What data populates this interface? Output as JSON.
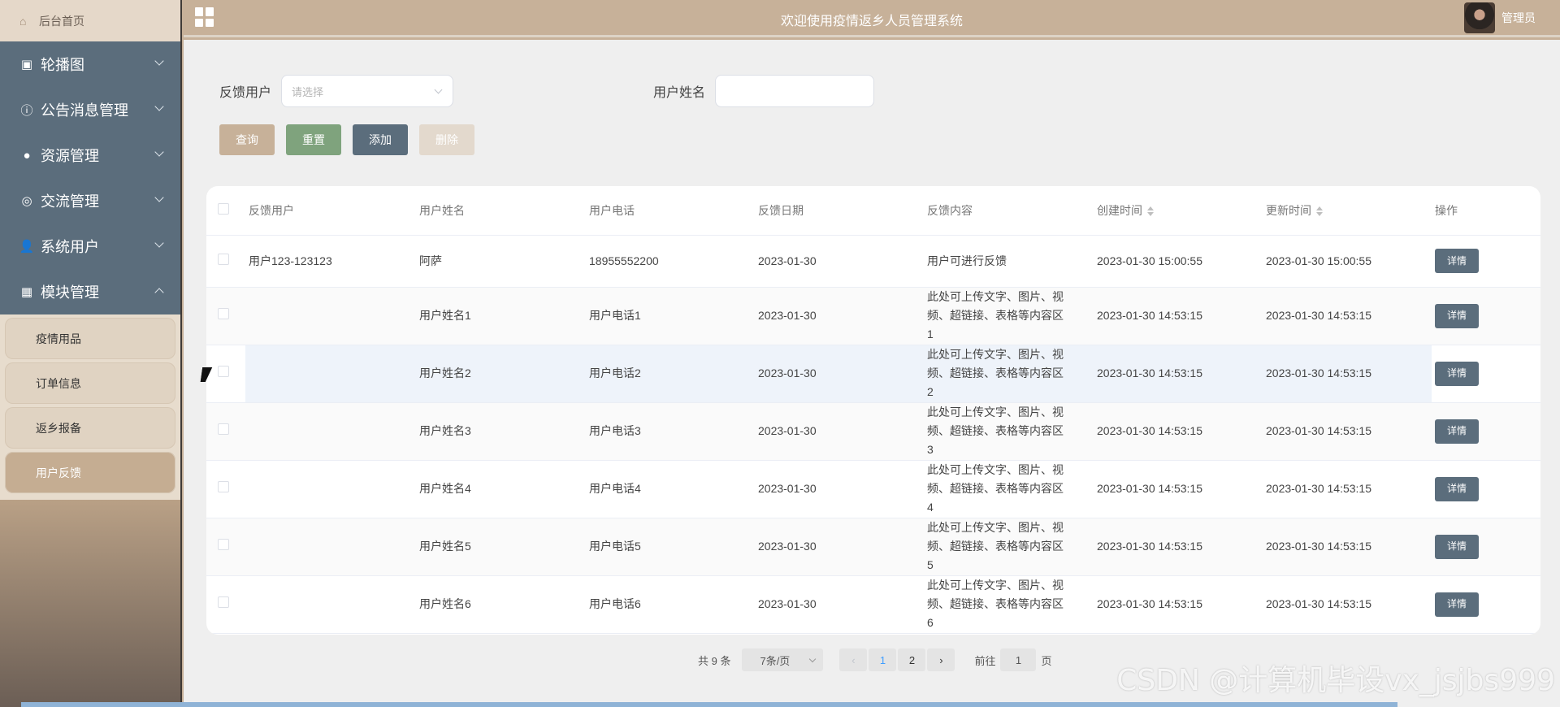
{
  "sidebar": {
    "home_label": "后台首页",
    "menu": [
      {
        "label": "轮播图",
        "icon": "image-icon"
      },
      {
        "label": "公告消息管理",
        "icon": "info-circle-icon"
      },
      {
        "label": "资源管理",
        "icon": "bulb-icon"
      },
      {
        "label": "交流管理",
        "icon": "chat-icon"
      },
      {
        "label": "系统用户",
        "icon": "user-icon"
      },
      {
        "label": "模块管理",
        "icon": "grid-icon"
      }
    ],
    "submenu": [
      "疫情用品",
      "订单信息",
      "返乡报备",
      "用户反馈"
    ],
    "active_submenu": "用户反馈"
  },
  "header": {
    "title": "欢迎使用疫情返乡人员管理系统",
    "user": "管理员"
  },
  "filters": {
    "feedback_user_label": "反馈用户",
    "feedback_user_placeholder": "请选择",
    "user_name_label": "用户姓名",
    "user_name_value": ""
  },
  "buttons": {
    "query": "查询",
    "reset": "重置",
    "add": "添加",
    "delete": "删除"
  },
  "table": {
    "columns": [
      "反馈用户",
      "用户姓名",
      "用户电话",
      "反馈日期",
      "反馈内容",
      "创建时间",
      "更新时间",
      "操作"
    ],
    "rows": [
      {
        "feedback_user": "用户123-123123",
        "name": "阿萨",
        "phone": "18955552200",
        "date": "2023-01-30",
        "content": "用户可进行反馈",
        "created": "2023-01-30 15:00:55",
        "updated": "2023-01-30 15:00:55",
        "action": "详情"
      },
      {
        "feedback_user": "",
        "name": "用户姓名1",
        "phone": "用户电话1",
        "date": "2023-01-30",
        "content": "此处可上传文字、图片、视频、超链接、表格等内容区1",
        "created": "2023-01-30 14:53:15",
        "updated": "2023-01-30 14:53:15",
        "action": "详情"
      },
      {
        "feedback_user": "",
        "name": "用户姓名2",
        "phone": "用户电话2",
        "date": "2023-01-30",
        "content": "此处可上传文字、图片、视频、超链接、表格等内容区2",
        "created": "2023-01-30 14:53:15",
        "updated": "2023-01-30 14:53:15",
        "action": "详情"
      },
      {
        "feedback_user": "",
        "name": "用户姓名3",
        "phone": "用户电话3",
        "date": "2023-01-30",
        "content": "此处可上传文字、图片、视频、超链接、表格等内容区3",
        "created": "2023-01-30 14:53:15",
        "updated": "2023-01-30 14:53:15",
        "action": "详情"
      },
      {
        "feedback_user": "",
        "name": "用户姓名4",
        "phone": "用户电话4",
        "date": "2023-01-30",
        "content": "此处可上传文字、图片、视频、超链接、表格等内容区4",
        "created": "2023-01-30 14:53:15",
        "updated": "2023-01-30 14:53:15",
        "action": "详情"
      },
      {
        "feedback_user": "",
        "name": "用户姓名5",
        "phone": "用户电话5",
        "date": "2023-01-30",
        "content": "此处可上传文字、图片、视频、超链接、表格等内容区5",
        "created": "2023-01-30 14:53:15",
        "updated": "2023-01-30 14:53:15",
        "action": "详情"
      },
      {
        "feedback_user": "",
        "name": "用户姓名6",
        "phone": "用户电话6",
        "date": "2023-01-30",
        "content": "此处可上传文字、图片、视频、超链接、表格等内容区6",
        "created": "2023-01-30 14:53:15",
        "updated": "2023-01-30 14:53:15",
        "action": "详情"
      }
    ]
  },
  "pagination": {
    "total": "共 9 条",
    "page_size": "7条/页",
    "pages": [
      "1",
      "2"
    ],
    "current": "1",
    "goto_label": "前往",
    "goto_value": "1",
    "goto_suffix": "页"
  },
  "watermark": "CSDN @计算机毕设vx_jsjbs999",
  "colors": {
    "sidebar_bg": "#c6ae93",
    "menu_bg": "#5b6d7c",
    "accent": "#c7b199",
    "reset_btn": "#7fa37d",
    "detail_btn": "#5b6d7c",
    "page_current": "#409eff"
  }
}
